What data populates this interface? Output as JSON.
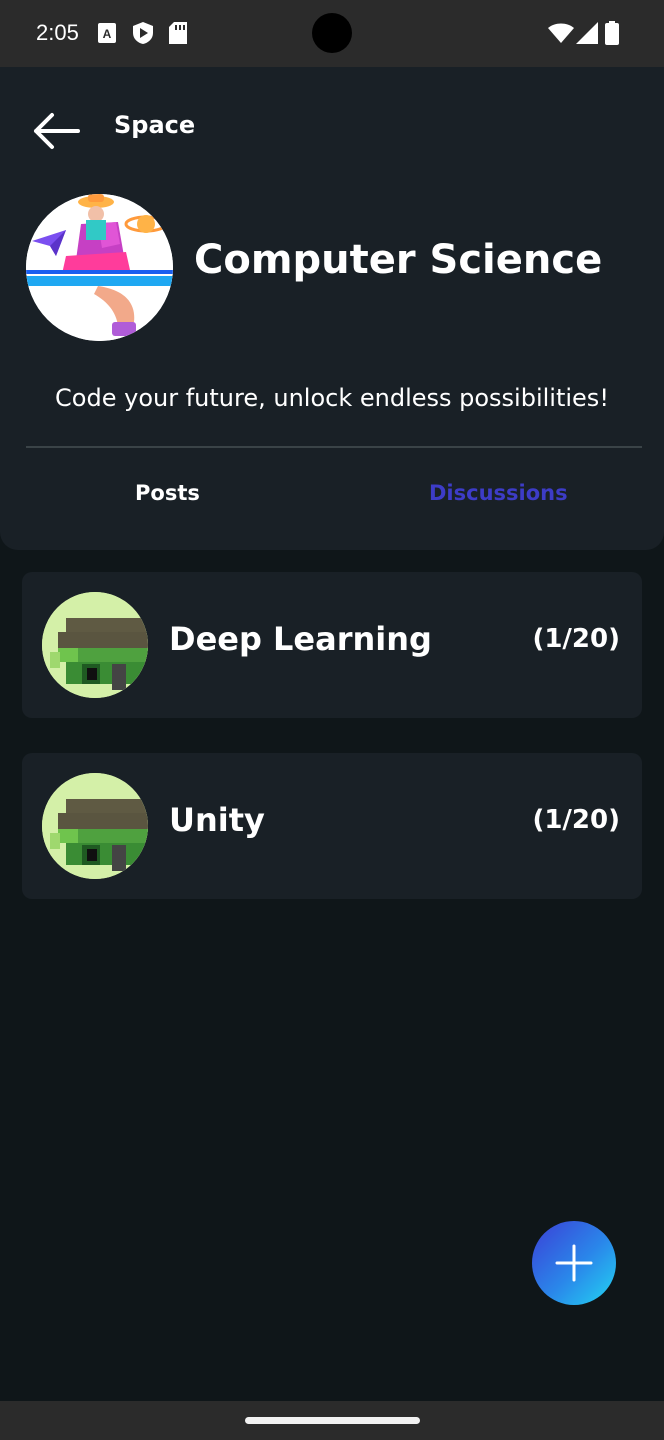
{
  "status_bar": {
    "time": "2:05",
    "icons": [
      "a-box-icon",
      "shield-play-icon",
      "sd-card-icon",
      "wifi-icon",
      "signal-icon",
      "battery-icon"
    ]
  },
  "header": {
    "back_icon": "arrow-left-icon",
    "title": "Space"
  },
  "space": {
    "name": "Computer Science",
    "tagline": "Code your future, unlock endless possibilities!"
  },
  "tabs": [
    {
      "label": "Posts",
      "active": false
    },
    {
      "label": "Discussions",
      "active": true
    }
  ],
  "discussions": [
    {
      "title": "Deep Learning",
      "count": "(1/20)"
    },
    {
      "title": "Unity",
      "count": "(1/20)"
    }
  ],
  "fab": {
    "icon": "plus-icon"
  },
  "colors": {
    "background": "#0f1619",
    "panel": "#192026",
    "accent_tab": "#3d3cc7",
    "fab_gradient_start": "#3b3fd6",
    "fab_gradient_end": "#22d6f2"
  }
}
